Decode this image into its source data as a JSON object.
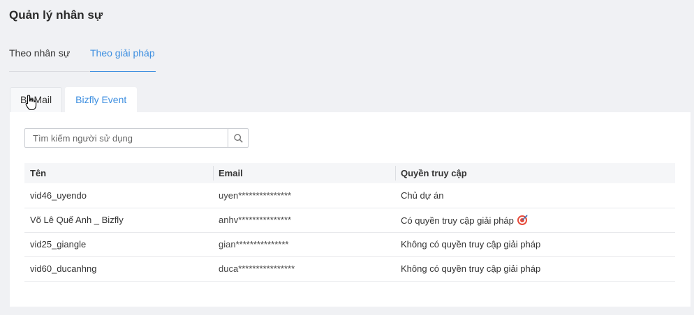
{
  "page": {
    "title": "Quản lý nhân sự"
  },
  "main_tabs": [
    {
      "label": "Theo nhân sự",
      "active": false
    },
    {
      "label": "Theo giải pháp",
      "active": true
    }
  ],
  "sub_tabs": [
    {
      "label": "BizMail",
      "active": false
    },
    {
      "label": "Bizfly Event",
      "active": true
    }
  ],
  "search": {
    "placeholder": "Tìm kiếm người sử dụng",
    "value": ""
  },
  "table": {
    "headers": [
      "Tên",
      "Email",
      "Quyền truy cập"
    ],
    "rows": [
      {
        "name": "vid46_uyendo",
        "email": "uyen***************",
        "access": "Chủ dự án"
      },
      {
        "name": "Võ Lê Quế Anh _ Bizfly",
        "email": "anhv***************",
        "access": "Có quyền truy cập giải pháp"
      },
      {
        "name": "vid25_giangle",
        "email": "gian***************",
        "access": "Không có quyền truy cập giải pháp"
      },
      {
        "name": "vid60_ducanhng",
        "email": "duca****************",
        "access": "Không có quyền truy cập giải pháp"
      }
    ]
  },
  "colors": {
    "accent": "#3c8ee0",
    "background": "#f0f1f4"
  },
  "icons": {
    "search": "search-icon",
    "target": "target-icon",
    "cursor": "hand-cursor-icon"
  }
}
